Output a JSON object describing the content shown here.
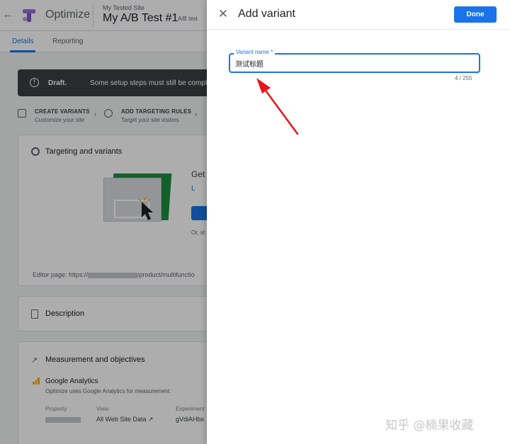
{
  "app": {
    "back_glyph": "←",
    "name": "Optimize",
    "site_name": "My Tested Site",
    "experience_name": "My A/B Test #1",
    "experience_type": "A/B test"
  },
  "tabs": [
    {
      "label": "Details",
      "active": true
    },
    {
      "label": "Reporting",
      "active": false
    }
  ],
  "draft_banner": {
    "info_glyph": "!",
    "bold": "Draft.",
    "message": "Some setup steps must still be completed"
  },
  "steps": [
    {
      "title": "CREATE VARIANTS",
      "subtitle": "Customize your site"
    },
    {
      "title": "ADD TARGETING RULES",
      "subtitle": "Target your site visitors"
    }
  ],
  "chevron_glyph": "›",
  "targeting_card": {
    "title": "Targeting and variants",
    "get_started": "Get",
    "learn_more": "L",
    "or_text": "Or, st",
    "editor_page_prefix": "Editor page: https://",
    "editor_page_suffix": "/product/multifunctio"
  },
  "description_card": {
    "title": "Description"
  },
  "measurement_card": {
    "title": "Measurement and objectives",
    "trend_glyph": "↗",
    "ga_title": "Google Analytics",
    "ga_subtitle": "Optimize uses Google Analytics for measurement.",
    "property_label": "Property",
    "view_label": "View",
    "view_value": "All Web Site Data ↗",
    "experiment_label": "Experiment",
    "experiment_value": "gVdiAHbx"
  },
  "panel": {
    "close_glyph": "✕",
    "title": "Add variant",
    "done_label": "Done",
    "field_label": "Variant name *",
    "field_value": "测试标题",
    "counter": "4 / 255"
  },
  "watermark": "知乎 @楠果收藏",
  "colors": {
    "accent": "#1a73e8",
    "annotation_arrow": "#e8141c",
    "draft_banner": "#3c4043"
  }
}
